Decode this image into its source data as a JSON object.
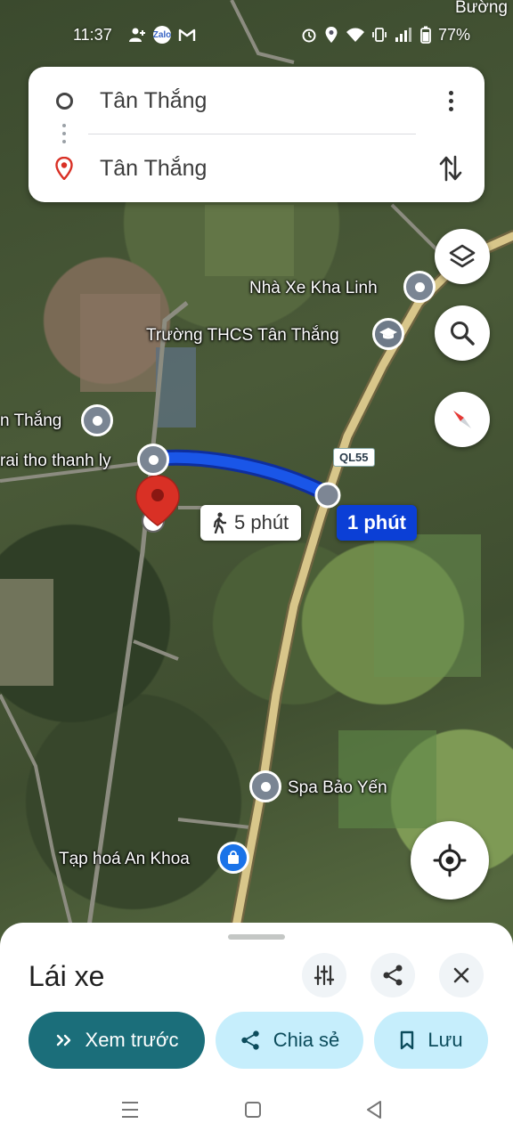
{
  "status_bar": {
    "time": "11:37",
    "battery": "77%",
    "icons_left": [
      "add-person-icon",
      "zalo-icon",
      "gmail-icon"
    ],
    "icons_right": [
      "alarm-icon",
      "location-icon",
      "wifi-icon",
      "vibrate-icon",
      "signal-icon",
      "battery-icon"
    ],
    "zalo_text": "Zalo"
  },
  "map_corner_label": "Bường",
  "directions": {
    "origin": "Tân Thắng",
    "destination": "Tân Thắng"
  },
  "map": {
    "pois": [
      {
        "label": "Nhà Xe Kha Linh",
        "type": "pin"
      },
      {
        "label": "Trường THCS Tân Thắng",
        "type": "school"
      },
      {
        "label": "n Thắng",
        "type": "pin"
      },
      {
        "label": "rai tho thanh ly",
        "type": "pin"
      },
      {
        "label": "Spa Bảo Yến",
        "type": "pin"
      },
      {
        "label": "Tạp hoá An Khoa",
        "type": "shop"
      }
    ],
    "road_shield": "QL55",
    "walk_time": "5 phút",
    "drive_time": "1 phút",
    "route_color": "#1a56e8"
  },
  "sheet": {
    "title": "Lái xe",
    "buttons": {
      "preview": "Xem trước",
      "share": "Chia sẻ",
      "save": "Lưu"
    }
  },
  "colors": {
    "primary_pill": "#1b6e7a",
    "secondary_pill": "#c6eefc",
    "destination_pin": "#d93025"
  }
}
